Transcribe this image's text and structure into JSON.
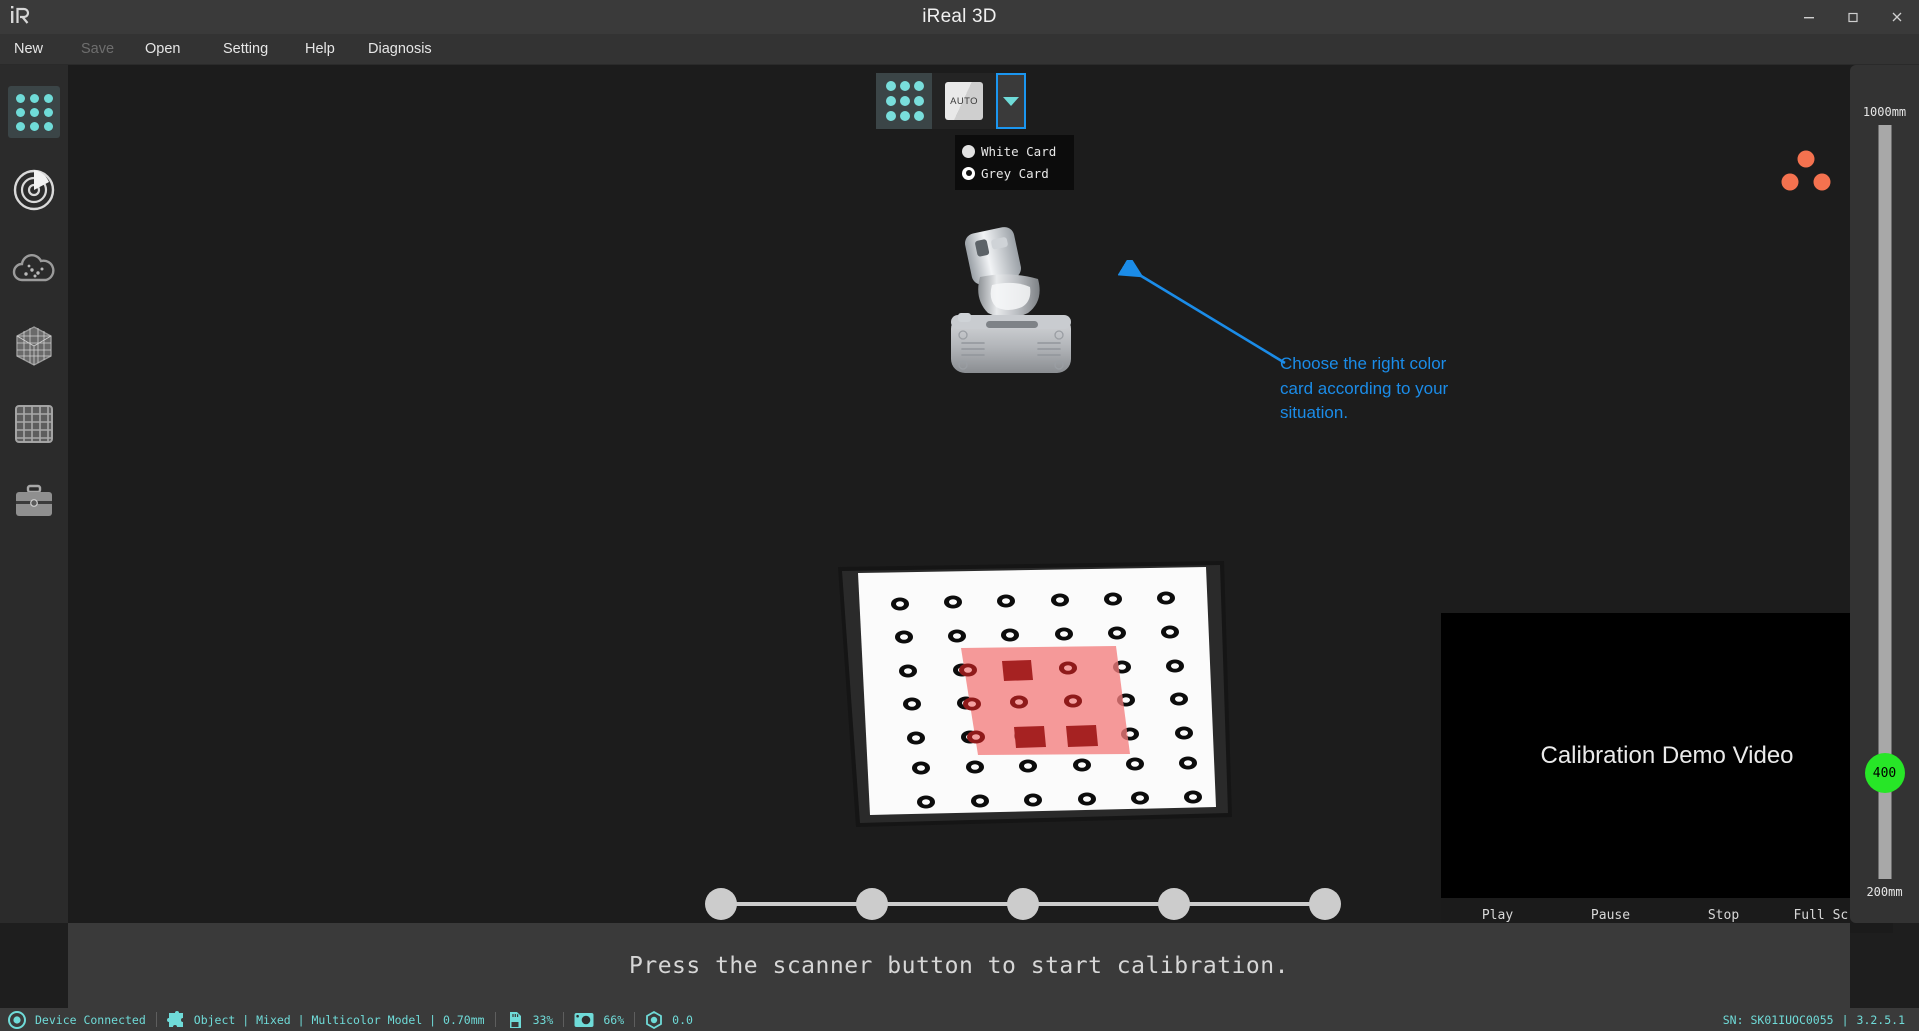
{
  "window": {
    "title": "iReal 3D",
    "logo_icon": "ireal-logo-icon",
    "minimize_label": "—",
    "maximize_label": "❐",
    "close_label": "✕"
  },
  "menubar": {
    "items": [
      {
        "label": "New",
        "disabled": false
      },
      {
        "label": "Save",
        "disabled": true
      },
      {
        "label": "Open",
        "disabled": false
      },
      {
        "label": "Setting",
        "disabled": false
      },
      {
        "label": "Help",
        "disabled": false
      },
      {
        "label": "Diagnosis",
        "disabled": false
      }
    ]
  },
  "sidebar": {
    "items": [
      {
        "name": "calibration",
        "icon": "dot-grid-icon",
        "active": true
      },
      {
        "name": "scan",
        "icon": "radar-scan-icon",
        "active": false
      },
      {
        "name": "point-cloud",
        "icon": "point-cloud-icon",
        "active": false
      },
      {
        "name": "mesh",
        "icon": "mesh-cube-icon",
        "active": false
      },
      {
        "name": "texture-grid",
        "icon": "grid-icon",
        "active": false
      },
      {
        "name": "toolbox",
        "icon": "toolbox-icon",
        "active": false
      }
    ]
  },
  "toolbar": {
    "grid_button_icon": "dot-grid-icon",
    "auto_label": "AUTO",
    "caret_icon": "chevron-down-icon"
  },
  "dropdown": {
    "options": [
      {
        "label": "White Card",
        "selected": false
      },
      {
        "label": "Grey Card",
        "selected": true
      }
    ]
  },
  "annotation": {
    "text": "Choose the right color card according to your situation.",
    "color": "#1b8ce8",
    "arrow_icon": "arrow-up-left-icon"
  },
  "tracking_markers": {
    "color": "#f4724f",
    "count": 3
  },
  "calibration_board": {
    "rows": 7,
    "cols": 6,
    "highlight_color": "#f78f8f",
    "marker_color": "#a62222",
    "dot_color": "#111111"
  },
  "steps": {
    "total": 5,
    "current": 0,
    "dot_color": "#cccccc"
  },
  "video": {
    "title": "Calibration Demo Video",
    "controls": [
      {
        "label": "Play"
      },
      {
        "label": "Pause"
      },
      {
        "label": "Stop"
      },
      {
        "label": "Full Screen"
      }
    ]
  },
  "depth_slider": {
    "max_label": "1000mm",
    "min_label": "200mm",
    "value_label": "400",
    "knob_color": "#27e627"
  },
  "hint": {
    "text": "Press the scanner button to start calibration."
  },
  "statusbar": {
    "device_status": "Device Connected",
    "device_icon": "device-dot-icon",
    "mode_icon": "mode-puzzle-icon",
    "mode_text": "Object | Mixed | Multicolor Model | 0.70mm",
    "storage_icon": "sd-card-icon",
    "storage_value": "33%",
    "camera_icon": "camera-icon",
    "camera_value": "66%",
    "gauge_icon": "hex-gauge-icon",
    "gauge_value": "0.0",
    "serial_label": "SN:",
    "serial_value": "SK01IUOC0055",
    "separator": "|",
    "version": "3.2.5.1",
    "accent_color": "#6fdbd8"
  }
}
